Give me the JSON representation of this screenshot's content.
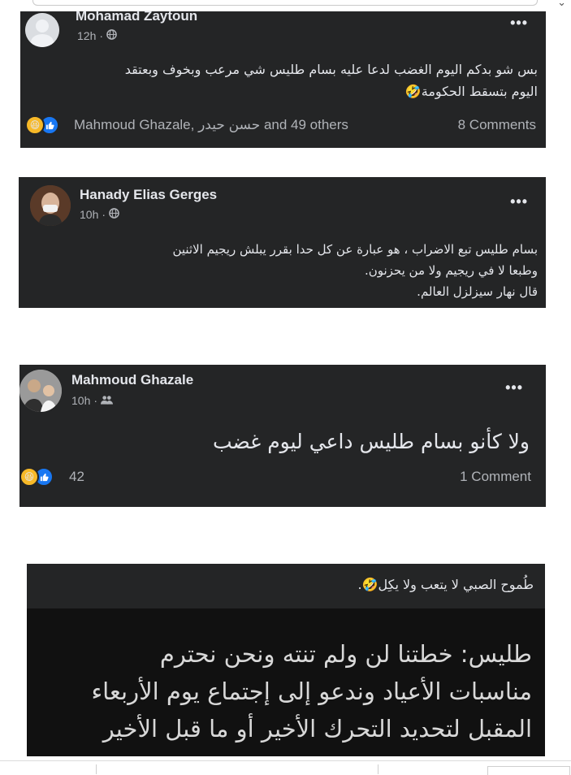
{
  "posts": [
    {
      "author": "Mohamad Zaytoun",
      "time": "12h",
      "privacy_icon": "globe-icon",
      "body_lines": [
        "بس شو بدكم اليوم الغضب لدعا عليه بسام طليس شي مرعب وبخوف وبعتقد",
        "اليوم بتسقط الحكومة🤣"
      ],
      "reactions_label": "Mahmoud Ghazale, حسن حيدر and 49 others",
      "comments": "8 Comments"
    },
    {
      "author": "Hanady Elias Gerges",
      "time": "10h",
      "privacy_icon": "globe-icon",
      "body_lines": [
        "بسام طليس تبع الاضراب ، هو عبارة عن كل حدا بقرر يبلش ريجيم الاثنين",
        "وطبعا لا في ريجيم ولا من يحزنون.",
        "قال نهار سيزلزل العالم."
      ]
    },
    {
      "author": "Mahmoud Ghazale",
      "time": "10h",
      "privacy_icon": "friends-icon",
      "body_lines": [
        "ولا كأنو بسام طليس داعي ليوم غضب"
      ],
      "reactions_label": "42",
      "comments": "1 Comment"
    }
  ],
  "shared": {
    "caption": "طُموح الصبي لا يتعب ولا يكِل🤣.",
    "image_lines": [
      "طليس: خطتنا لن ولم تنته ونحن نحترم",
      "مناسبات الأعياد وندعو إلى إجتماع يوم الأربعاء",
      "المقبل لتحديد التحرك الأخير أو ما قبل الأخير"
    ]
  },
  "colors": {
    "card": "#242526",
    "text": "#e4e6eb",
    "muted": "#b0b3b8",
    "like": "#1877f2",
    "haha": "#f7b928"
  }
}
